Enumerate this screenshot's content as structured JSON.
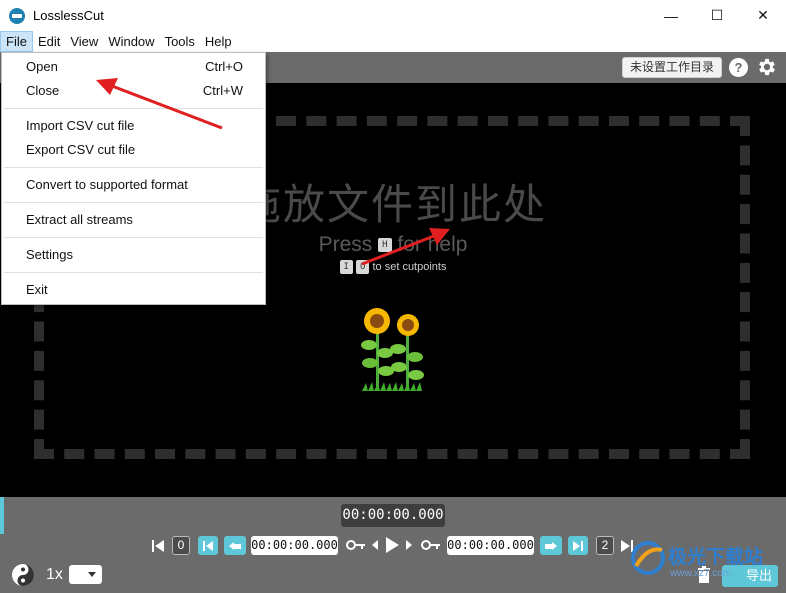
{
  "window": {
    "title": "LosslessCut",
    "controls": {
      "minimize": "—",
      "maximize": "☐",
      "close": "✕"
    }
  },
  "menubar": {
    "items": [
      "File",
      "Edit",
      "View",
      "Window",
      "Tools",
      "Help"
    ],
    "active": "File"
  },
  "file_menu": {
    "items": [
      {
        "label": "Open",
        "shortcut": "Ctrl+O"
      },
      {
        "label": "Close",
        "shortcut": "Ctrl+W"
      },
      {
        "label": "Import CSV cut file",
        "shortcut": ""
      },
      {
        "label": "Export CSV cut file",
        "shortcut": ""
      },
      {
        "label": "Convert to supported format",
        "shortcut": ""
      },
      {
        "label": "Extract all streams",
        "shortcut": ""
      },
      {
        "label": "Settings",
        "shortcut": ""
      },
      {
        "label": "Exit",
        "shortcut": ""
      }
    ]
  },
  "topbar": {
    "workdir_button": "未设置工作目录",
    "help_icon": "?",
    "settings_icon": "gear-icon"
  },
  "main": {
    "drop_title": "拖放文件到此处",
    "press_prefix": "Press",
    "press_key": "H",
    "press_suffix": "for help",
    "cut_key_in": "I",
    "cut_key_out": "O",
    "cut_text": "to set cutpoints",
    "illustration": "sunflower"
  },
  "timeline": {
    "current_time": "00:00:00.000"
  },
  "controls": {
    "segment_start_index": "0",
    "start_time": "00:00:00.000",
    "end_time": "00:00:00.000",
    "segment_end_index": "2",
    "speed": "1x",
    "export_label": "导出"
  },
  "colors": {
    "accent": "#5ec8d8",
    "toolbar_gray": "#6b6b6b",
    "canvas_black": "#000000",
    "arrow_red": "#e02020"
  },
  "watermark": {
    "text": "极光下载站",
    "url": "www.xz7.com"
  }
}
